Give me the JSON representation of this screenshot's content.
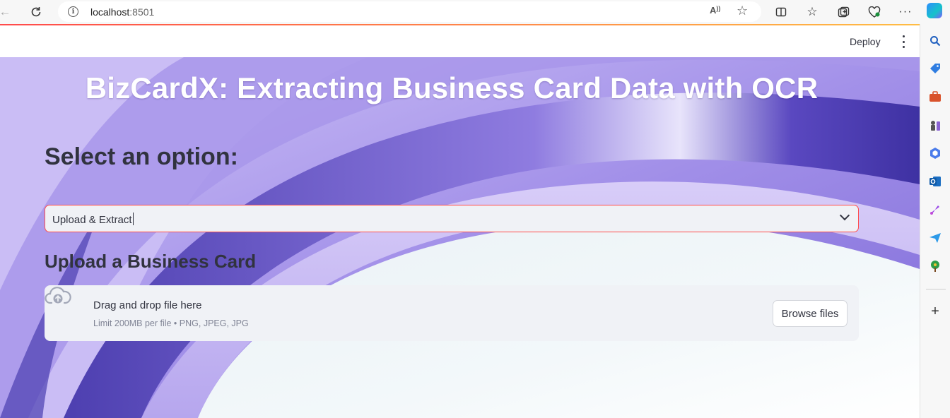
{
  "browser": {
    "url_host": "localhost",
    "url_port": ":8501"
  },
  "header": {
    "deploy_label": "Deploy"
  },
  "main": {
    "title": "BizCardX: Extracting Business Card Data with OCR",
    "select_heading": "Select an option:",
    "select_value": "Upload & Extract",
    "upload_heading": "Upload a Business Card",
    "uploader": {
      "instruction": "Drag and drop file here",
      "limit": "Limit 200MB per file • PNG, JPEG, JPG",
      "button_label": "Browse files"
    }
  },
  "colors": {
    "accent": "#ff4b4b",
    "text": "#31333f",
    "widget_bg": "#f0f2f6"
  },
  "icons": [
    "back-icon",
    "refresh-icon",
    "info-icon",
    "read-aloud-icon",
    "favorite-icon",
    "split-screen-icon",
    "favorites-icon",
    "collections-icon",
    "browser-essentials-icon",
    "more-icon",
    "copilot-icon",
    "search-icon",
    "shopping-icon",
    "tools-icon",
    "games-icon",
    "microsoft-365-icon",
    "outlook-icon",
    "designer-icon",
    "send-icon",
    "tree-icon",
    "add-icon",
    "cloud-upload-icon",
    "chevron-down-icon",
    "kebab-menu-icon"
  ]
}
